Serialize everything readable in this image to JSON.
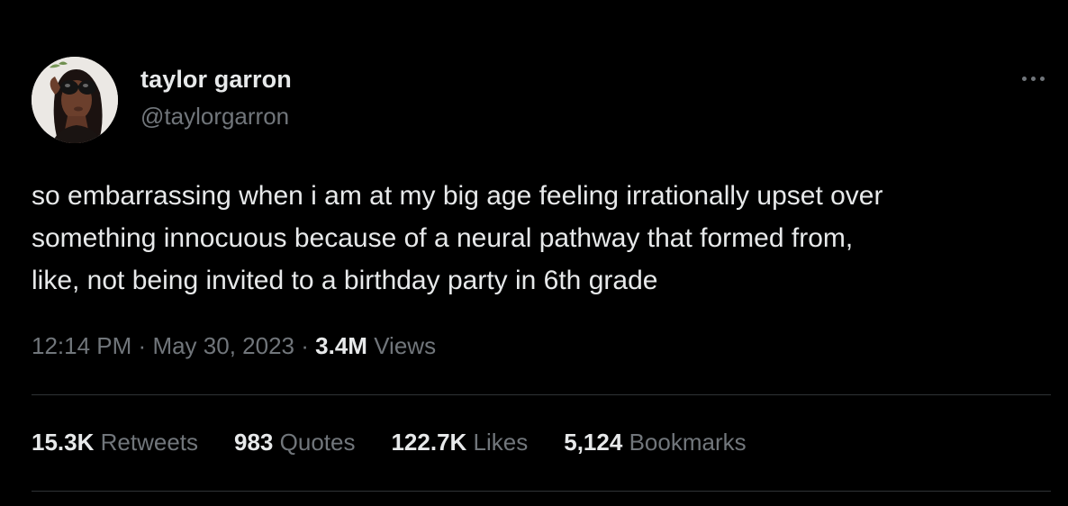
{
  "author": {
    "display_name": "taylor garron",
    "handle": "@taylorgarron",
    "avatar_icon": "profile-photo"
  },
  "menu": {
    "icon": "more-horizontal-icon"
  },
  "tweet": {
    "lines": [
      "so embarrassing when i am at my big age feeling irrationally upset over",
      "something innocuous because of a neural pathway that formed from,",
      "like, not being invited to a birthday party in 6th grade"
    ]
  },
  "meta": {
    "time": "12:14 PM",
    "sep1": "·",
    "date": "May 30, 2023",
    "sep2": "·",
    "views_count": "3.4M",
    "views_label": "Views"
  },
  "stats": {
    "retweets": {
      "count": "15.3K",
      "label": "Retweets"
    },
    "quotes": {
      "count": "983",
      "label": "Quotes"
    },
    "likes": {
      "count": "122.7K",
      "label": "Likes"
    },
    "bookmarks": {
      "count": "5,124",
      "label": "Bookmarks"
    }
  },
  "colors": {
    "background": "#000000",
    "primary_text": "#e7e9ea",
    "secondary_text": "#71767b",
    "divider": "#2f3336"
  }
}
